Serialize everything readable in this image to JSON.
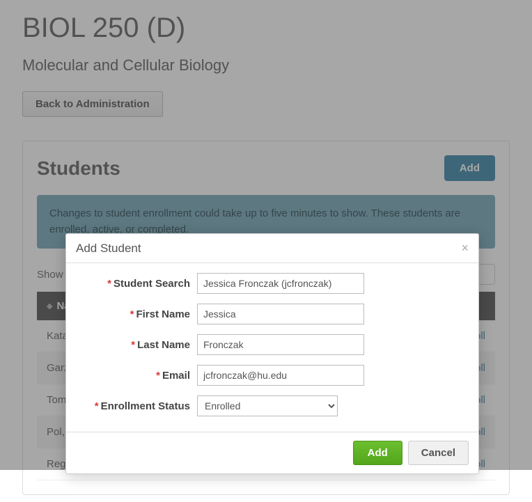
{
  "course": {
    "title": "BIOL 250 (D)",
    "subtitle": "Molecular and Cellular Biology"
  },
  "nav": {
    "back_label": "Back to Administration"
  },
  "panel": {
    "title": "Students",
    "add_label": "Add",
    "alert": "Changes to student enrollment could take up to five minutes to show. These students are enrolled, active, or completed.",
    "show_label": "Show",
    "name_col": "Na",
    "unenroll_suffix": "oll",
    "rows": [
      "Kata",
      "Garz",
      "Tom",
      "Pol,",
      "Reg"
    ]
  },
  "modal": {
    "title": "Add Student",
    "fields": {
      "search_label": "Student Search",
      "search_value": "Jessica Fronczak (jcfronczak)",
      "first_label": "First Name",
      "first_value": "Jessica",
      "last_label": "Last Name",
      "last_value": "Fronczak",
      "email_label": "Email",
      "email_value": "jcfronczak@hu.edu",
      "status_label": "Enrollment Status",
      "status_value": "Enrolled"
    },
    "add_label": "Add",
    "cancel_label": "Cancel"
  }
}
